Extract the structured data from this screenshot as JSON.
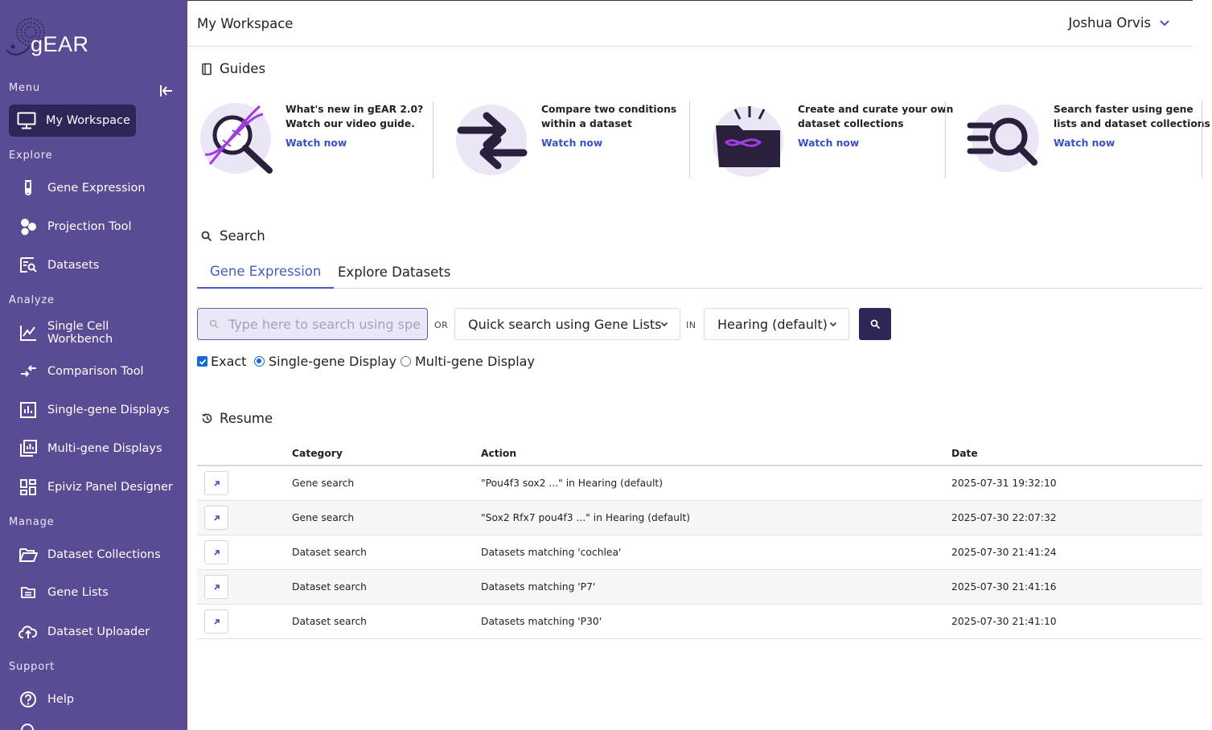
{
  "app": {
    "logo_text": "gEAR"
  },
  "sidebar": {
    "menu_label": "Menu",
    "explore_label": "Explore",
    "analyze_label": "Analyze",
    "manage_label": "Manage",
    "support_label": "Support",
    "items": {
      "my_workspace": "My Workspace",
      "gene_expression": "Gene Expression",
      "projection_tool": "Projection Tool",
      "datasets": "Datasets",
      "single_cell_workbench": "Single Cell Workbench",
      "comparison_tool": "Comparison Tool",
      "single_gene_displays": "Single-gene Displays",
      "multi_gene_displays": "Multi-gene Displays",
      "epiviz_panel_designer": "Epiviz Panel Designer",
      "dataset_collections": "Dataset Collections",
      "gene_lists": "Gene Lists",
      "dataset_uploader": "Dataset Uploader",
      "help": "Help"
    }
  },
  "header": {
    "title": "My Workspace",
    "user_name": "Joshua Orvis"
  },
  "guides": {
    "title": "Guides",
    "items": [
      {
        "text": "What's new in gEAR 2.0? Watch our video guide.",
        "link": "Watch now",
        "icon": "dna-magnifier-icon"
      },
      {
        "text": "Compare two conditions within a dataset",
        "link": "Watch now",
        "icon": "opposing-arrows-icon"
      },
      {
        "text": "Create and curate your own dataset collections",
        "link": "Watch now",
        "icon": "dna-folder-icon"
      },
      {
        "text": "Search faster using gene lists and dataset collections",
        "link": "Watch now",
        "icon": "list-search-icon"
      }
    ]
  },
  "search": {
    "title": "Search",
    "tabs": [
      "Gene Expression",
      "Explore Datasets"
    ],
    "input_placeholder": "Type here to search using specific genes",
    "or_label": "OR",
    "in_label": "IN",
    "gene_list_select": "Quick search using Gene Lists",
    "collection_select": "Hearing (default)",
    "exact_label": "Exact",
    "single_gene_label": "Single-gene Display",
    "multi_gene_label": "Multi-gene Display"
  },
  "resume": {
    "title": "Resume",
    "columns": {
      "category": "Category",
      "action": "Action",
      "date": "Date"
    },
    "rows": [
      {
        "category": "Gene search",
        "action": "\"Pou4f3 sox2 ...\" in Hearing (default)",
        "date": "2025-07-31 19:32:10"
      },
      {
        "category": "Gene search",
        "action": "\"Sox2 Rfx7 pou4f3 ...\" in Hearing (default)",
        "date": "2025-07-30 22:07:32"
      },
      {
        "category": "Dataset search",
        "action": "Datasets matching 'cochlea'",
        "date": "2025-07-30 21:41:24"
      },
      {
        "category": "Dataset search",
        "action": "Datasets matching 'P7'",
        "date": "2025-07-30 21:41:16"
      },
      {
        "category": "Dataset search",
        "action": "Datasets matching 'P30'",
        "date": "2025-07-30 21:41:10"
      }
    ]
  },
  "colors": {
    "sidebar": "#5b4a94",
    "sidebar_active": "#2f2556",
    "accent": "#4a5ac6",
    "link": "#3a4fc0"
  }
}
